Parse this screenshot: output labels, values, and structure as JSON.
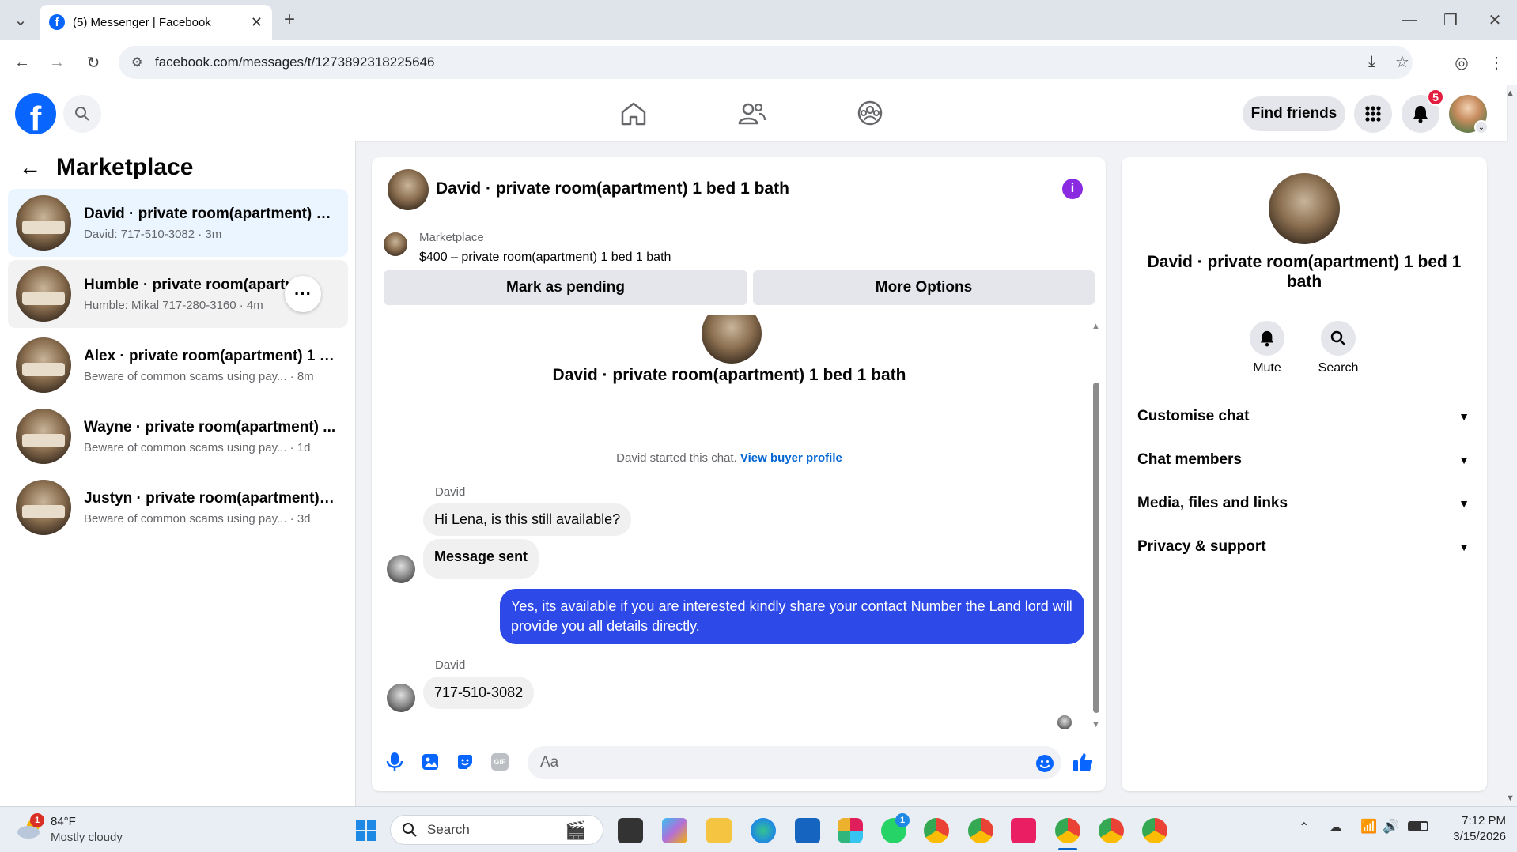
{
  "browser": {
    "tab_title": "(5) Messenger | Facebook",
    "url": "facebook.com/messages/t/1273892318225646"
  },
  "fb_header": {
    "find_friends": "Find friends",
    "notification_count": "5"
  },
  "left_panel": {
    "title": "Marketplace",
    "conversations": [
      {
        "title": "David · private room(apartment) 1 ...",
        "subtitle": "David: 717-510-3082 · 3m"
      },
      {
        "title": "Humble · private room(apartm...",
        "subtitle": "Humble: Mikal 717-280-3160 · 4m"
      },
      {
        "title": "Alex · private room(apartment) 1 b...",
        "subtitle": "Beware of common scams using pay... · 8m"
      },
      {
        "title": "Wayne · private room(apartment) ...",
        "subtitle": "Beware of common scams using pay... · 1d"
      },
      {
        "title": "Justyn · private room(apartment) 1...",
        "subtitle": "Beware of common scams using pay... · 3d"
      }
    ]
  },
  "chat": {
    "header_title": "David · private room(apartment) 1 bed 1 bath",
    "listing_source": "Marketplace",
    "listing_price_title": "$400 – private room(apartment) 1 bed 1 bath",
    "mark_pending": "Mark as pending",
    "more_options": "More Options",
    "intro_title": "David · private room(apartment) 1 bed 1 bath",
    "started_text": "David started this chat.",
    "view_buyer_profile": "View buyer profile",
    "messages": [
      {
        "sender": "David",
        "text": "Hi Lena, is this still available?"
      },
      {
        "sender": "",
        "text": "Message sent"
      },
      {
        "sender": "me",
        "text": "Yes, its available if you are interested kindly share your contact Number the Land lord will provide you all details directly."
      },
      {
        "sender": "David",
        "text": "717-510-3082"
      }
    ],
    "input_placeholder": "Aa"
  },
  "info_panel": {
    "title": "David · private room(apartment) 1 bed 1 bath",
    "mute": "Mute",
    "search": "Search",
    "sections": [
      "Customise chat",
      "Chat members",
      "Media, files and links",
      "Privacy & support"
    ]
  },
  "taskbar": {
    "weather_temp": "84°F",
    "weather_desc": "Mostly cloudy",
    "weather_badge": "1",
    "search": "Search",
    "whatsapp_badge": "1",
    "time": "7:12 PM",
    "date": "3/15/2026"
  },
  "colors": {
    "fb_blue": "#0866ff",
    "outgoing_bubble": "#2d4ae8",
    "info_purple": "#8a2be2",
    "notification_red": "#e41e3f"
  }
}
